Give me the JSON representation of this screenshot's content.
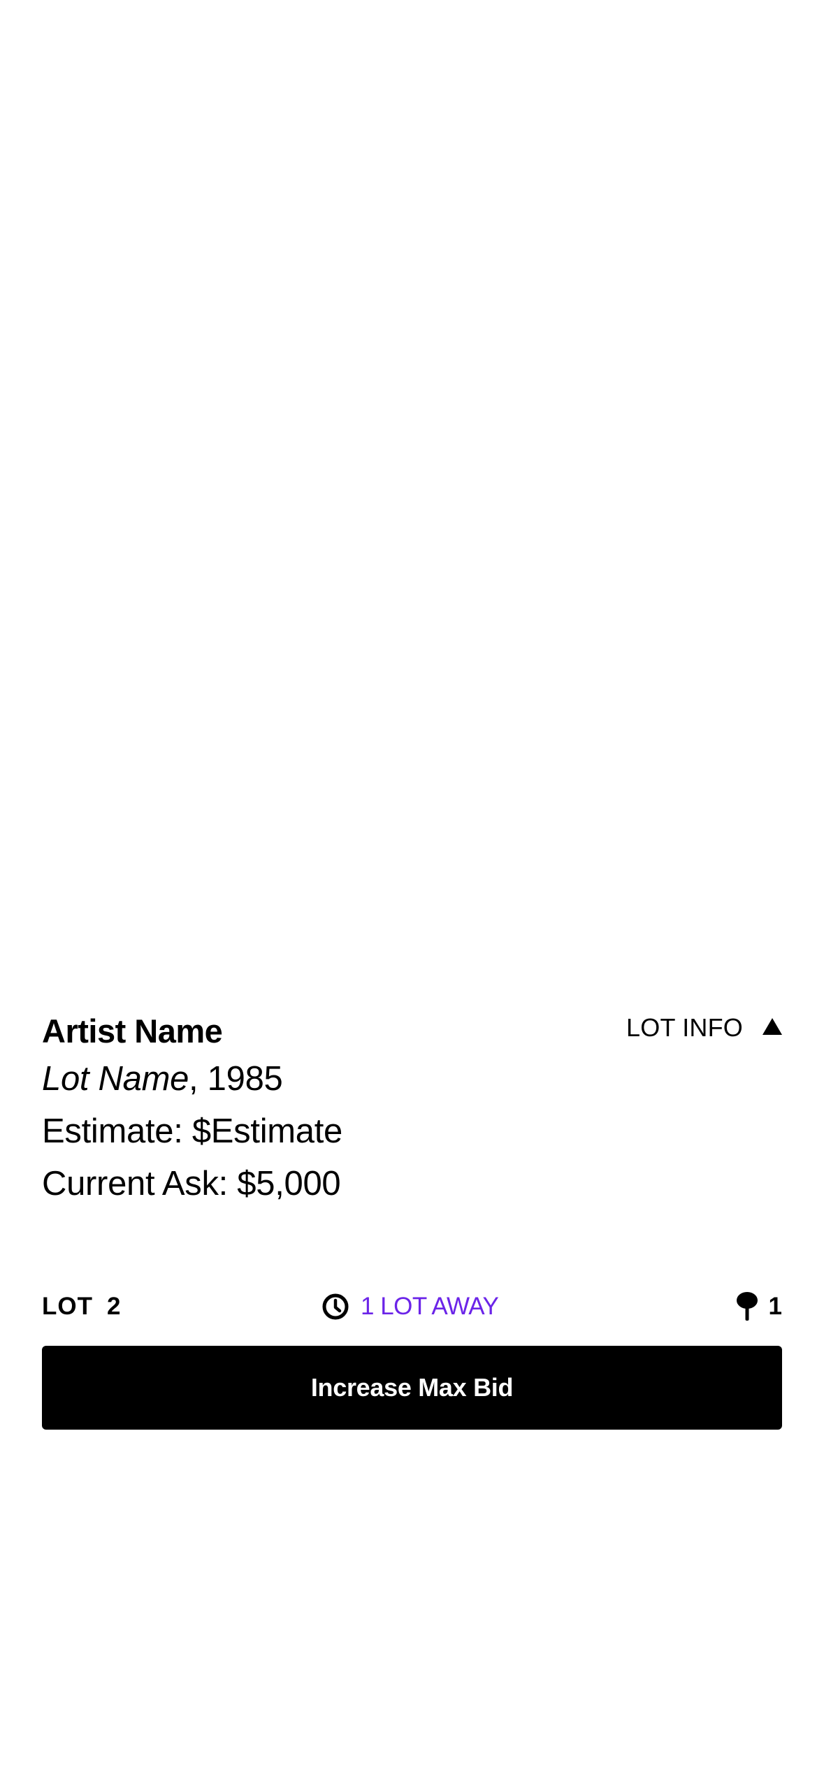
{
  "lot": {
    "artist": "Artist Name",
    "title": "Lot Name",
    "year_suffix": ", 1985",
    "estimate": "Estimate: $Estimate",
    "current_ask": "Current Ask: $5,000",
    "info_toggle_label": "LOT INFO",
    "info_toggle_icon": "triangle-up-icon"
  },
  "status": {
    "lot_label": "LOT",
    "lot_number": "2",
    "countdown_icon": "clock-icon",
    "countdown_text": "1 LOT AWAY",
    "countdown_color": "#6b24e8",
    "paddle_icon": "paddle-icon",
    "paddle_count": "1"
  },
  "actions": {
    "increase_max_bid_label": "Increase Max Bid",
    "button_color": "#000000"
  }
}
